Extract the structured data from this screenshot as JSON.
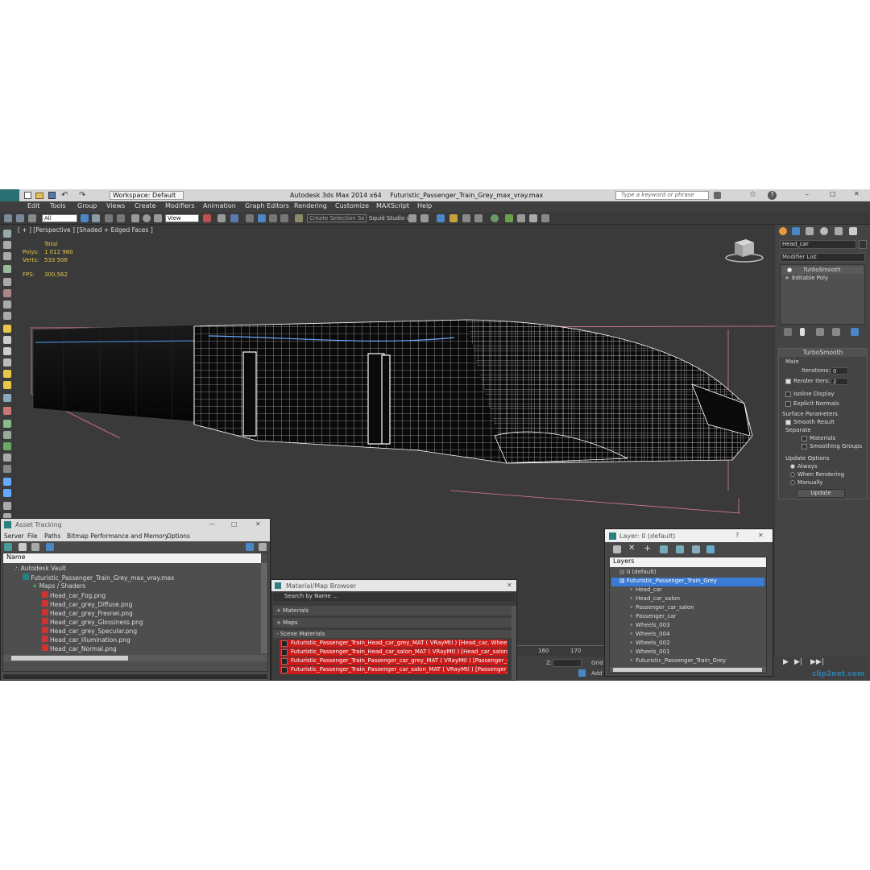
{
  "app": {
    "title": "Autodesk 3ds Max  2014 x64",
    "file": "Futuristic_Passenger_Train_Grey_max_vray.max",
    "workspace": "Workspace: Default",
    "search_placeholder": "Type a keyword or phrase"
  },
  "menu": [
    "Edit",
    "Tools",
    "Group",
    "Views",
    "Create",
    "Modifiers",
    "Animation",
    "Graph Editors",
    "Rendering",
    "Customize",
    "MAXScript",
    "Help"
  ],
  "toolbar": {
    "filter": "All",
    "refcoord": "View",
    "selection_set": "Create Selection Se",
    "squid": "Squid Studio v"
  },
  "viewport": {
    "label": "[ + ] [Perspective ] [Shaded + Edged Faces ]",
    "stats": {
      "total_label": "Total",
      "polys_label": "Polys:",
      "polys_value": "1 012 980",
      "verts_label": "Verts:",
      "verts_value": "533 506",
      "fps_label": "FPS:",
      "fps_value": "300,562"
    }
  },
  "cmdpanel": {
    "object_name": "Head_car",
    "modifier_list": "Modifier List",
    "stack": [
      "TurboSmooth",
      "Editable Poly"
    ],
    "rollout_title": "TurboSmooth",
    "main_label": "Main",
    "iterations_label": "Iterations:",
    "iterations_value": "0",
    "render_iters_label": "Render Iters:",
    "render_iters_value": "2",
    "isoline": "Isoline Display",
    "explicit": "Explicit Normals",
    "surface_params": "Surface Parameters",
    "smooth_result": "Smooth Result",
    "separate": "Separate",
    "materials": "Materials",
    "smoothing_groups": "Smoothing Groups",
    "update_options": "Update Options",
    "always": "Always",
    "when_rendering": "When Rendering",
    "manually": "Manually",
    "update_btn": "Update"
  },
  "asset_tracking": {
    "title": "Asset Tracking",
    "menu": [
      "Server",
      "File",
      "Paths",
      "Bitmap Performance and Memory",
      "Options"
    ],
    "col_name": "Name",
    "rows": [
      "Autodesk Vault",
      "Futuristic_Passenger_Train_Grey_max_vray.max",
      "Maps / Shaders",
      "Head_car_Fog.png",
      "Head_car_grey_Diffuse.png",
      "Head_car_grey_Fresnel.png",
      "Head_car_grey_Glossiness.png",
      "Head_car_grey_Specular.png",
      "Head_car_Illumination.png",
      "Head_car_Normal.png"
    ]
  },
  "material_browser": {
    "title": "Material/Map Browser",
    "search": "Search by Name ...",
    "sections": [
      "+ Materials",
      "+ Maps",
      "- Scene Materials"
    ],
    "materials": [
      "Futuristic_Passenger_Train_Head_car_grey_MAT  ( VRayMtl )  [Head_car, Wheel...",
      "Futuristic_Passenger_Train_Head_car_salon_MAT  ( VRayMtl )  [Head_car_salon]",
      "Futuristic_Passenger_Train_Passenger_car_grey_MAT  ( VRayMtl )  [Passenger_c...",
      "Futuristic_Passenger_Train_Passenger_car_salon_MAT  ( VRayMtl )  [Passenger_..."
    ]
  },
  "layers": {
    "title": "Layer: 0 (default)",
    "header": "Layers",
    "rows": [
      "0 (default)",
      "Futuristic_Passenger_Train_Grey",
      "Head_car",
      "Head_car_salon",
      "Passenger_car_salon",
      "Passenger_car",
      "Wheels_003",
      "Wheels_004",
      "Wheels_002",
      "Wheels_001",
      "Futuristic_Passenger_Train_Grey"
    ]
  },
  "timeline": {
    "tick_160": "160",
    "tick_170": "170",
    "z_label": "Z:",
    "grid": "Grid",
    "add_t": "Add T"
  },
  "watermark": "clip2net.com"
}
